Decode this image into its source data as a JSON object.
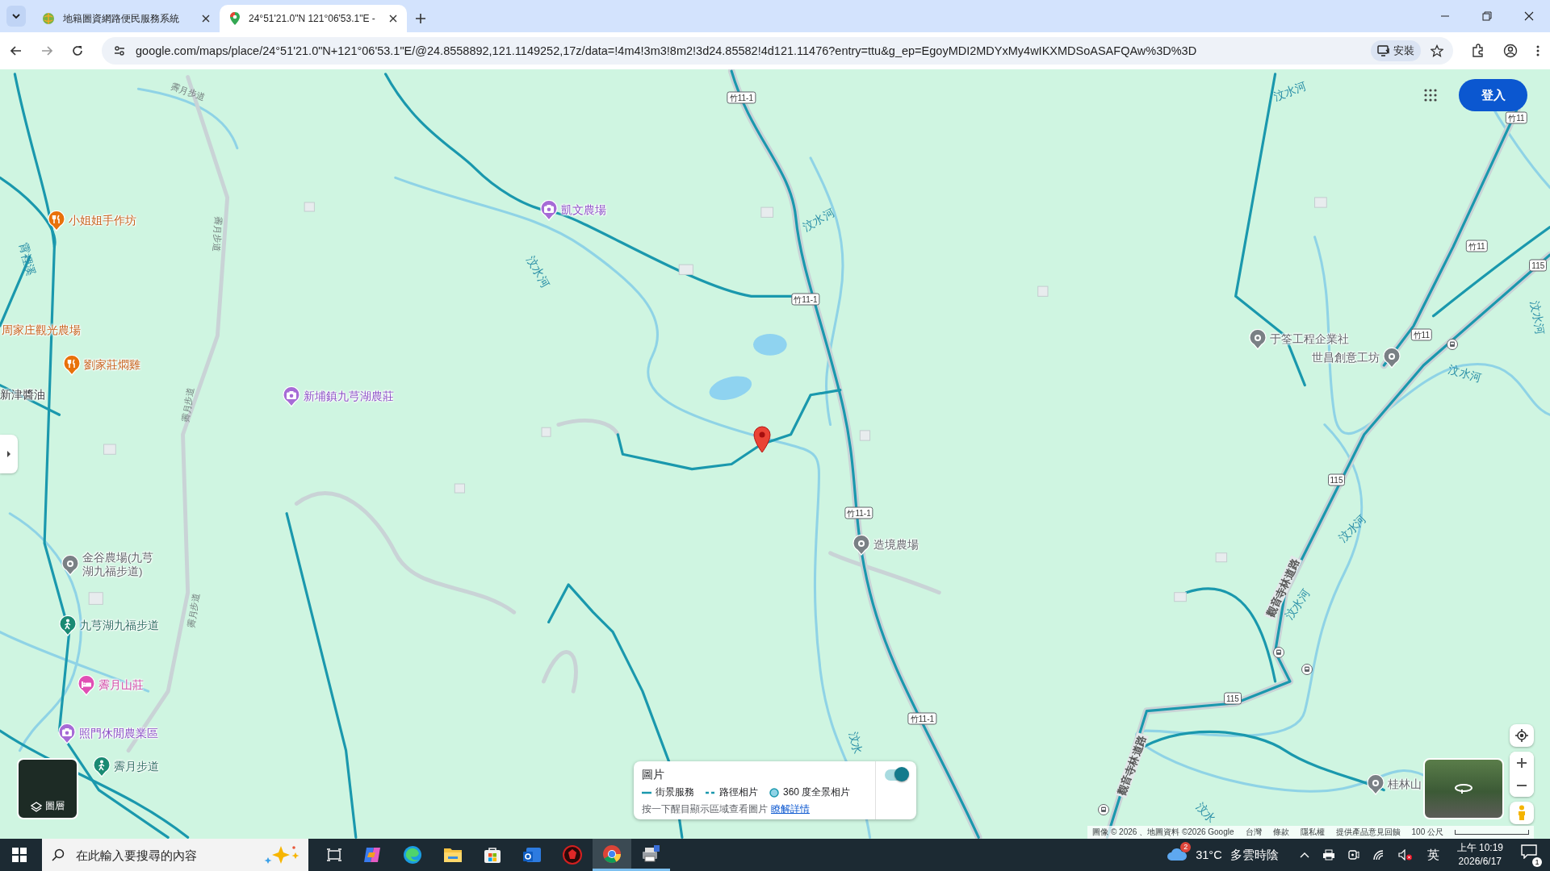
{
  "browser": {
    "tabs": [
      {
        "title": "地籍圖資網路便民服務系統",
        "selected": false
      },
      {
        "title": "24°51'21.0\"N 121°06'53.1\"E -",
        "selected": true
      }
    ],
    "url": "google.com/maps/place/24°51'21.0\"N+121°06'53.1\"E/@24.8558892,121.1149252,17z/data=!4m4!3m3!8m2!3d24.85582!4d121.11476?entry=ttu&g_ep=EgoyMDI2MDYxMy4wIKXMDSoASAFQAw%3D%3D",
    "install_label": "安裝"
  },
  "map": {
    "sign_in": "登入",
    "places": [
      {
        "name": "小姐姐手作坊",
        "kind": "food"
      },
      {
        "name": "周家庄觀光農場",
        "kind": "foodname"
      },
      {
        "name": "劉家莊燜雞",
        "kind": "food"
      },
      {
        "name": "新津醬油",
        "kind": "name"
      },
      {
        "name": "新埔鎮九芎湖農莊",
        "kind": "photo"
      },
      {
        "name": "凱文農場",
        "kind": "photo"
      },
      {
        "name": "金谷農場(九芎湖九福步道)",
        "kind": "pin"
      },
      {
        "name": "九芎湖九福步道",
        "kind": "trail"
      },
      {
        "name": "霽月山莊",
        "kind": "lodging"
      },
      {
        "name": "照門休閒農業區",
        "kind": "photo"
      },
      {
        "name": "霽月步道",
        "kind": "trail"
      },
      {
        "name": "造境農場",
        "kind": "pin"
      },
      {
        "name": "于筌工程企業社",
        "kind": "pin"
      },
      {
        "name": "世昌創意工坊",
        "kind": "pin"
      },
      {
        "name": "桂林山",
        "kind": "pin"
      }
    ],
    "road_shields": [
      "竹11-1",
      "竹11-1",
      "竹11-1",
      "竹11-1",
      "竹11",
      "竹11",
      "竹11",
      "115",
      "115",
      "115"
    ],
    "map_labels": [
      {
        "text": "汶水河",
        "kind": "river"
      },
      {
        "text": "汶水河",
        "kind": "river"
      },
      {
        "text": "汶水河",
        "kind": "river"
      },
      {
        "text": "汶水河",
        "kind": "river"
      },
      {
        "text": "汶水河",
        "kind": "river"
      },
      {
        "text": "汶水河",
        "kind": "river"
      },
      {
        "text": "汶水河",
        "kind": "river"
      },
      {
        "text": "汶水",
        "kind": "river"
      },
      {
        "text": "汶水",
        "kind": "river"
      },
      {
        "text": "霄裡溪",
        "kind": "river"
      },
      {
        "text": "霽月步道",
        "kind": "path"
      },
      {
        "text": "霽月步道",
        "kind": "path"
      },
      {
        "text": "霽月步道",
        "kind": "path"
      },
      {
        "text": "霽月步道",
        "kind": "path"
      },
      {
        "text": "觀音寺林道路",
        "kind": "road"
      },
      {
        "text": "觀音寺林道路",
        "kind": "road"
      }
    ],
    "layers_label": "圖層",
    "photos_panel": {
      "title": "圖片",
      "toggle_on": true,
      "legend": [
        {
          "label": "街景服務",
          "kind": "line"
        },
        {
          "label": "路徑相片",
          "kind": "dashed"
        },
        {
          "label": "360 度全景相片",
          "kind": "dot"
        }
      ],
      "hint": "按一下醒目顯示區域查看圖片",
      "link": "瞭解詳情"
    },
    "attribution": [
      "圖像 © 2026 、地圖資料 ©2026 Google",
      "台灣",
      "條款",
      "隱私權",
      "提供產品意見回饋"
    ],
    "scale": "100 公尺"
  },
  "taskbar": {
    "search_placeholder": "在此輸入要搜尋的內容",
    "weather_badge": "2",
    "temperature": "31°C",
    "weather": "多雲時陰",
    "ime": "英",
    "time": "上午 10:19",
    "date": "2026/6/17",
    "notification_count": "1"
  }
}
